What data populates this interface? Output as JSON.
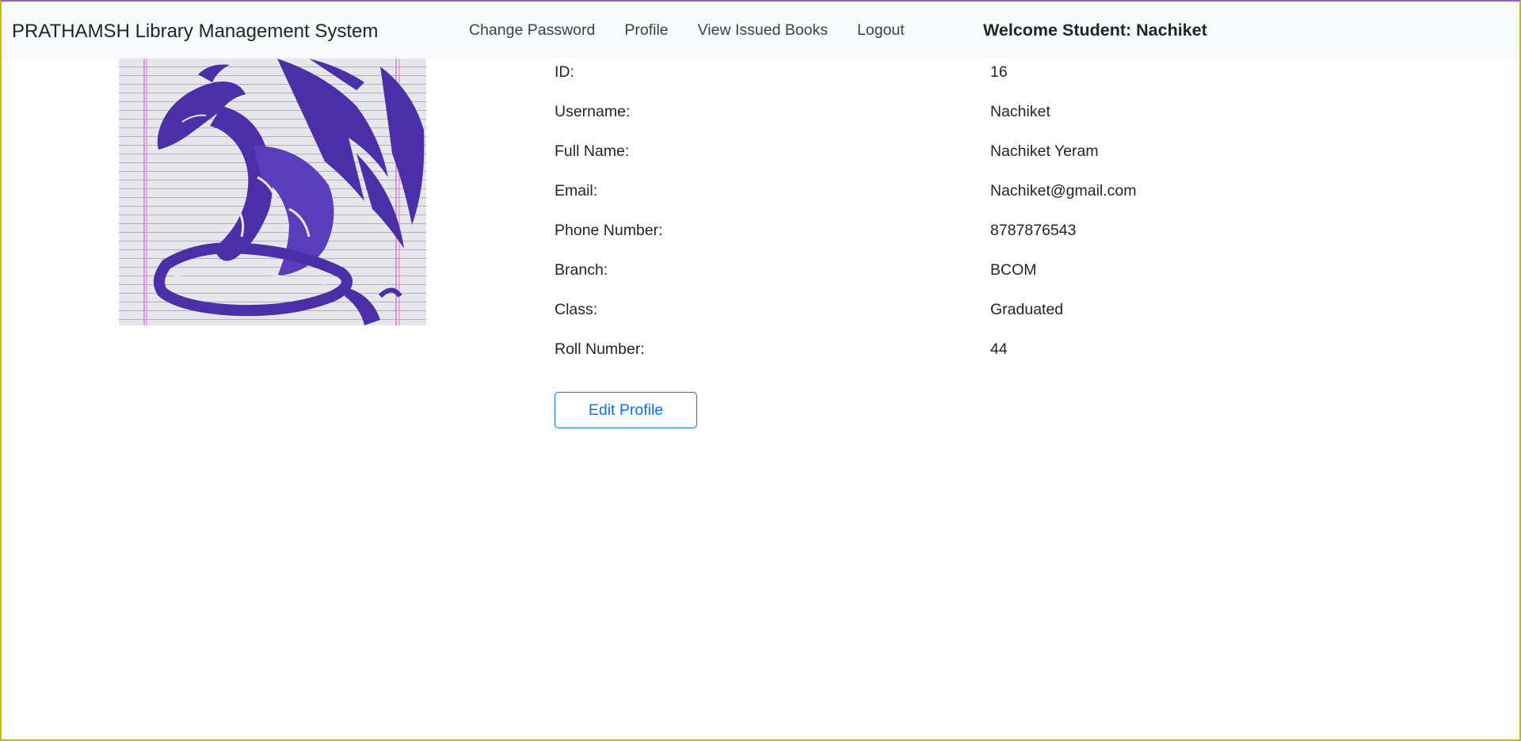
{
  "navbar": {
    "brand": "PRATHAMSH Library Management System",
    "links": [
      {
        "label": "Change Password"
      },
      {
        "label": "Profile"
      },
      {
        "label": "View Issued Books"
      },
      {
        "label": "Logout"
      }
    ],
    "welcome": "Welcome Student: Nachiket"
  },
  "profile": {
    "photo_icon": "profile-photo-dragon-drawing",
    "fields": [
      {
        "label": "ID:",
        "value": "16"
      },
      {
        "label": "Username:",
        "value": "Nachiket"
      },
      {
        "label": "Full Name:",
        "value": "Nachiket Yeram"
      },
      {
        "label": "Email:",
        "value": "Nachiket@gmail.com"
      },
      {
        "label": "Phone Number:",
        "value": "8787876543"
      },
      {
        "label": "Branch:",
        "value": "BCOM"
      },
      {
        "label": "Class:",
        "value": "Graduated"
      },
      {
        "label": "Roll Number:",
        "value": "44"
      }
    ],
    "edit_button": "Edit Profile"
  },
  "colors": {
    "navbar_bg": "#f8f9fa",
    "primary": "#0d6efd",
    "text": "#212529",
    "ink": "#4a2fa8"
  }
}
